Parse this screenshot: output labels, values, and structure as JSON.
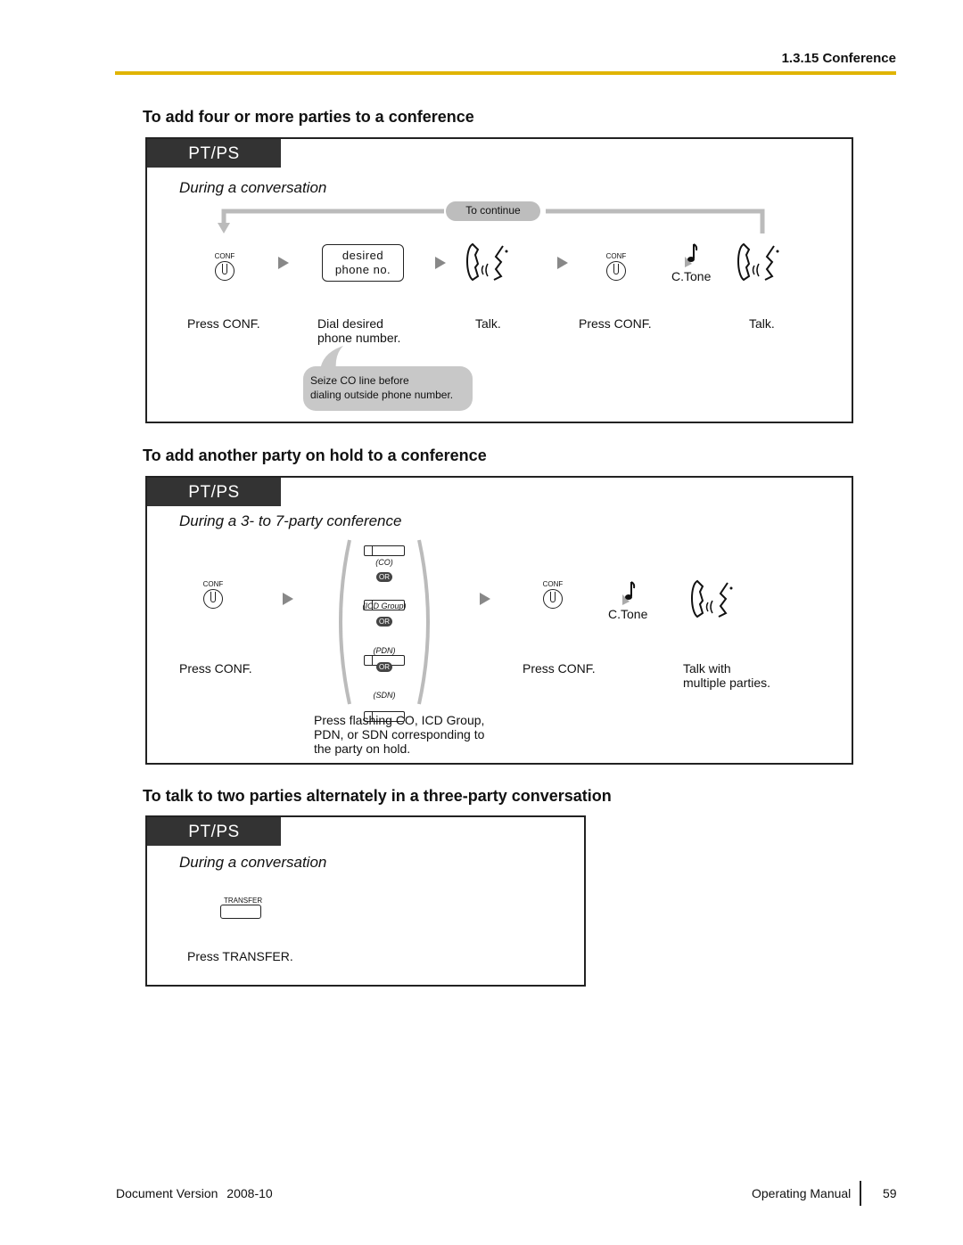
{
  "header": {
    "section_title": "1.3.15 Conference"
  },
  "sections": [
    {
      "title": "To add four or more parties to a conference",
      "tag": "PT/PS",
      "condition": "During a conversation",
      "loop_label": "To continue",
      "conf_key_label": "CONF",
      "phone_box": [
        "desired",
        "phone no."
      ],
      "tone_label": "C.Tone",
      "captions": [
        "Press CONF.",
        "Dial desired",
        "phone number.",
        "Talk.",
        "Press CONF.",
        "Talk."
      ],
      "note": [
        "Seize CO line before",
        "dialing outside phone number."
      ]
    },
    {
      "title": "To add another party on hold to a conference",
      "tag": "PT/PS",
      "condition": "During a 3- to 7-party conference",
      "conf_key_label": "CONF",
      "or_label": "OR",
      "line_keys": [
        "(CO)",
        "(ICD Group)",
        "(PDN)",
        "(SDN)"
      ],
      "tone_label": "C.Tone",
      "captions": [
        "Press CONF.",
        "Press CONF.",
        "Talk with",
        "multiple parties."
      ],
      "note": [
        "Press flashing CO, ICD Group,",
        "PDN, or SDN corresponding to",
        "the party on hold."
      ]
    },
    {
      "title": "To talk to two parties alternately in a three-party conversation",
      "tag": "PT/PS",
      "condition": "During a conversation",
      "transfer_key_label": "TRANSFER",
      "captions": [
        "Press TRANSFER."
      ]
    }
  ],
  "footer": {
    "doc_version_label": "Document Version",
    "doc_version": "2008-10",
    "manual": "Operating Manual",
    "page": "59"
  },
  "colors": {
    "accent_rule": "#e0b400",
    "tag_bg": "#333333",
    "bubble_bg": "#c8c8c8"
  }
}
